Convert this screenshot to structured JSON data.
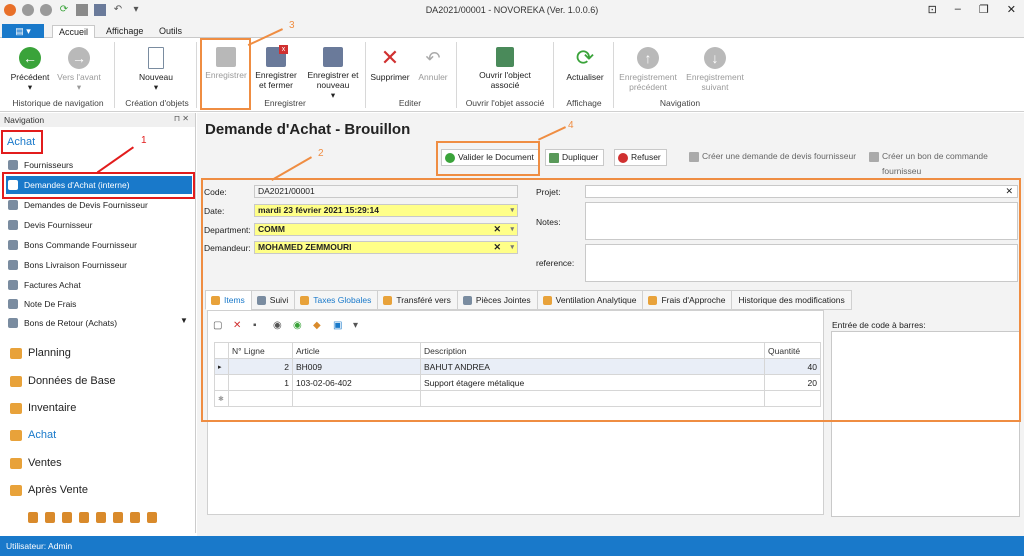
{
  "window": {
    "title": "DA2021/00001 - NOVOREKA (Ver. 1.0.0.6)"
  },
  "ribbon_tabs": [
    "Accueil",
    "Affichage",
    "Outils"
  ],
  "ribbon": {
    "precedent": "Précédent",
    "vers_avant": "Vers l'avant",
    "nouveau": "Nouveau",
    "enregistrer": "Enregistrer",
    "enregistrer_fermer": "Enregistrer et fermer",
    "enregistrer_nouveau": "Enregistrer et nouveau",
    "supprimer": "Supprimer",
    "annuler": "Annuler",
    "ouvrir": "Ouvrir l'object associé",
    "actualiser": "Actualiser",
    "enreg_precedent": "Enregistrement précédent",
    "enreg_suivant": "Enregistrement suivant",
    "groups": [
      "Historique de navigation",
      "Création d'objets",
      "Enregistrer",
      "Editer",
      "Ouvrir l'objet associé",
      "Affichage",
      "Navigation"
    ]
  },
  "nav": {
    "header": "Navigation",
    "section": "Achat",
    "items": [
      "Fournisseurs",
      "Demandes d'Achat (interne)",
      "Demandes de Devis Fournisseur",
      "Devis Fournisseur",
      "Bons Commande Fournisseur",
      "Bons Livraison Fournisseur",
      "Factures Achat",
      "Note De Frais",
      "Bons de Retour (Achats)"
    ],
    "modules": [
      "Planning",
      "Données de Base",
      "Inventaire",
      "Achat",
      "Ventes",
      "Après Vente"
    ]
  },
  "doc": {
    "title": "Demande d'Achat - Brouillon",
    "buttons": {
      "valider": "Valider le Document",
      "dupliquer": "Dupliquer",
      "refuser": "Refuser",
      "creer_devis": "Créer une demande de devis fournisseur",
      "creer_bon": "Créer un bon de commande fournisseu"
    },
    "labels": {
      "code": "Code:",
      "date": "Date:",
      "department": "Department:",
      "demandeur": "Demandeur:",
      "projet": "Projet:",
      "notes": "Notes:",
      "reference": "reference:"
    },
    "values": {
      "code": "DA2021/00001",
      "date": "mardi 23 février 2021 15:29:14",
      "department": "COMM",
      "demandeur": "MOHAMED ZEMMOURI"
    }
  },
  "tabs": [
    "Items",
    "Suivi",
    "Taxes Globales",
    "Transféré vers",
    "Pièces Jointes",
    "Ventilation Analytique",
    "Frais d'Approche",
    "Historique des modifications"
  ],
  "grid": {
    "headers": [
      "N° Ligne",
      "Article",
      "Description",
      "Quantité"
    ],
    "rows": [
      {
        "ligne": "2",
        "article": "BH009",
        "description": "BAHUT ANDREA",
        "qty": "40"
      },
      {
        "ligne": "1",
        "article": "103-02-06-402",
        "description": "Support étagere métalique",
        "qty": "20"
      }
    ]
  },
  "barcode_label": "Entrée de code à barres:",
  "status": "Utilisateur: Admin",
  "callouts": [
    "1",
    "2",
    "3",
    "4"
  ],
  "colors": {
    "accent": "#1979ca",
    "callout_orange": "#ef8d42",
    "callout_red": "#e21c1c",
    "required_yellow": "#ffff88"
  }
}
